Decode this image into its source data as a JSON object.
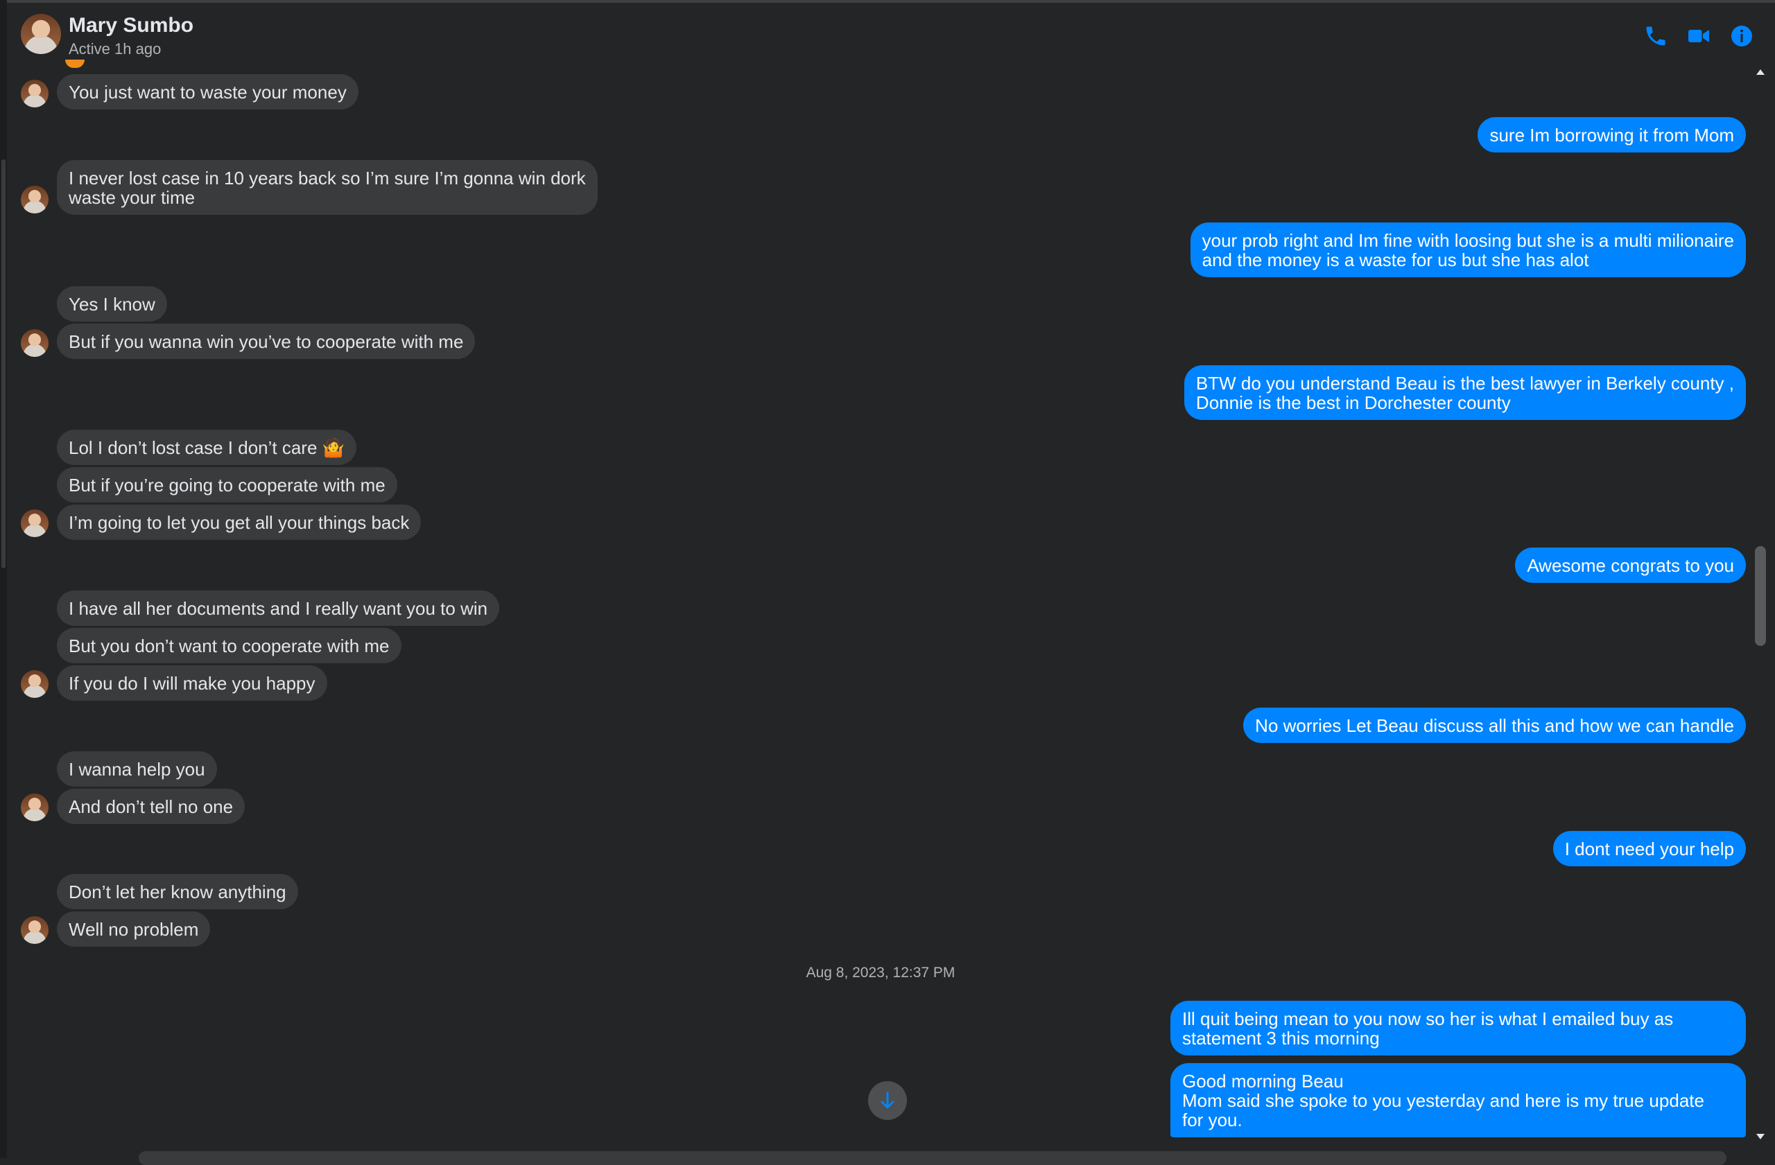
{
  "header": {
    "name": "Mary Sumbo",
    "status": "Active 1h ago",
    "icons": [
      "phone-icon",
      "video-camera-icon",
      "info-icon"
    ]
  },
  "colors": {
    "accent": "#0084ff",
    "incoming_bubble": "#3a3b3c",
    "background": "#242526"
  },
  "messages": [
    {
      "side": "incoming",
      "text": "You just want to waste your money"
    },
    {
      "side": "outgoing",
      "text": "sure Im borrowing it from Mom"
    },
    {
      "side": "incoming",
      "text": "I never lost case in 10 years back so I’m sure I’m gonna win dork\nwaste your time"
    },
    {
      "side": "outgoing",
      "text": "your prob right and Im fine with loosing but she is a multi milionaire\nand the money is a waste for us but she has alot"
    },
    {
      "side": "incoming",
      "text": "Yes I know"
    },
    {
      "side": "incoming",
      "text": "But if you wanna win you’ve to cooperate with me"
    },
    {
      "side": "outgoing",
      "text": "BTW do you understand Beau is the best lawyer in Berkely county ,\nDonnie is the best in Dorchester county"
    },
    {
      "side": "incoming",
      "text": "Lol I don’t lost case I don’t care 🤷"
    },
    {
      "side": "incoming",
      "text": "But if you’re going to cooperate with me"
    },
    {
      "side": "incoming",
      "text": "I’m going to let you get all your things back"
    },
    {
      "side": "outgoing",
      "text": "Awesome congrats to you"
    },
    {
      "side": "incoming",
      "text": "I have all her documents and I really want you to win"
    },
    {
      "side": "incoming",
      "text": "But you don’t want to cooperate with me"
    },
    {
      "side": "incoming",
      "text": "If you do I will make you happy"
    },
    {
      "side": "outgoing",
      "text": "No worries Let Beau discuss all this and how we can handle"
    },
    {
      "side": "incoming",
      "text": "I wanna help you"
    },
    {
      "side": "incoming",
      "text": "And don’t tell no one"
    },
    {
      "side": "outgoing",
      "text": "I dont need your help"
    },
    {
      "side": "incoming",
      "text": "Don’t let her know anything"
    },
    {
      "side": "incoming",
      "text": "Well no problem"
    },
    {
      "side": "outgoing",
      "text": "Ill quit being mean to you now so her is what I emailed buy as\nstatement 3 this morning"
    },
    {
      "side": "outgoing",
      "text": "Good morning Beau\nMom said she spoke to you yesterday and here is my true update\nfor you."
    }
  ],
  "timestamp": "Aug 8, 2023, 12:37 PM"
}
